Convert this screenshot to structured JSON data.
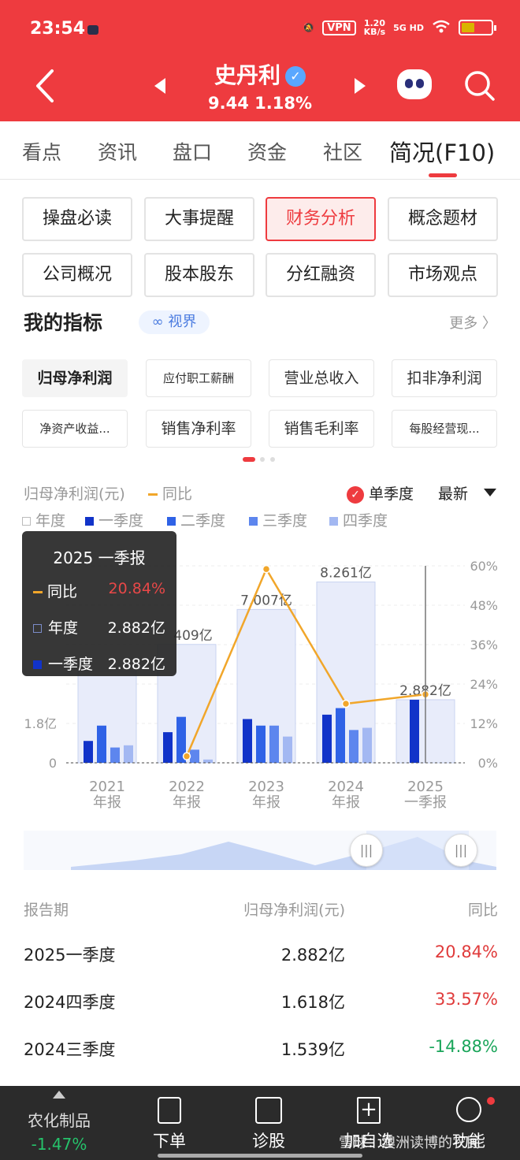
{
  "status_bar": {
    "time": "23:54",
    "vpn": "VPN",
    "speed_top": "1.20",
    "speed_bottom": "KB/s",
    "network": "5G HD"
  },
  "header": {
    "stock_name": "史丹利",
    "verified_icon": "✓",
    "price": "9.44",
    "change_pct": "1.18%"
  },
  "tabs": [
    "看点",
    "资讯",
    "盘口",
    "资金",
    "社区",
    "简况(F10)"
  ],
  "active_tab": 5,
  "quick_buttons": [
    "操盘必读",
    "大事提醒",
    "财务分析",
    "概念题材",
    "公司概况",
    "股本股东",
    "分红融资",
    "市场观点"
  ],
  "active_quick": 2,
  "indicators": {
    "title": "我的指标",
    "view_chip": "∞ 视界",
    "more": "更多 〉",
    "items": [
      "归母净利润",
      "应付职工薪酬",
      "营业总收入",
      "扣非净利润",
      "净资产收益...",
      "销售净利率",
      "销售毛利率",
      "每股经营现..."
    ]
  },
  "chart_header": {
    "title": "归母净利润(元)",
    "yoy": "同比",
    "single_quarter": "单季度",
    "check": "✓",
    "latest": "最新"
  },
  "legend": [
    "年度",
    "一季度",
    "二季度",
    "三季度",
    "四季度"
  ],
  "colors": {
    "brand_red": "#ee3b3f",
    "annual": "#e8ecfa",
    "q1": "#1133c9",
    "q2": "#2f62e6",
    "q3": "#5d86ee",
    "q4": "#a3b8f2",
    "yoy": "#f1a62a",
    "up": "#e03b3b",
    "down": "#1aa55a"
  },
  "chart_data": {
    "type": "bar",
    "categories": [
      "2021\n年报",
      "2022\n年报",
      "2023\n年报",
      "2024\n年报",
      "2025\n一季报"
    ],
    "series": [
      {
        "name": "年度",
        "values": [
          null,
          5.409,
          7.007,
          8.261,
          2.882
        ]
      },
      {
        "name": "一季度",
        "values": [
          1.0,
          1.4,
          2.0,
          2.2,
          2.882
        ]
      },
      {
        "name": "二季度",
        "values": [
          1.7,
          2.1,
          1.7,
          2.5,
          null
        ]
      },
      {
        "name": "三季度",
        "values": [
          0.7,
          0.6,
          1.7,
          1.5,
          null
        ]
      },
      {
        "name": "四季度",
        "values": [
          0.8,
          0.15,
          1.2,
          1.6,
          null
        ]
      }
    ],
    "bar_labels": [
      "",
      "409亿",
      "7.007亿",
      "8.261亿",
      "2.882亿"
    ],
    "yoy_line": {
      "name": "同比",
      "values": [
        null,
        2.0,
        59.0,
        18.0,
        20.84
      ]
    },
    "y_left_ticks": [
      "0",
      "1.8亿"
    ],
    "y_right_ticks": [
      "0%",
      "12%",
      "24%",
      "36%",
      "48%",
      "60%"
    ],
    "ylim_left": [
      0,
      9.0
    ],
    "ylim_right": [
      0,
      60
    ]
  },
  "tooltip": {
    "title": "2025 一季报",
    "rows": [
      {
        "label": "同比",
        "value": "20.84%"
      },
      {
        "label": "年度",
        "value": "2.882亿"
      },
      {
        "label": "一季度",
        "value": "2.882亿"
      }
    ]
  },
  "table": {
    "headers": [
      "报告期",
      "归母净利润(元)",
      "同比"
    ],
    "rows": [
      {
        "period": "2025一季度",
        "value": "2.882亿",
        "yoy": "20.84%",
        "dir": "up"
      },
      {
        "period": "2024四季度",
        "value": "1.618亿",
        "yoy": "33.57%",
        "dir": "up"
      },
      {
        "period": "2024三季度",
        "value": "1.539亿",
        "yoy": "-14.88%",
        "dir": "down"
      }
    ]
  },
  "bottom_bar": {
    "sector_name": "农化制品",
    "sector_change": "-1.47%",
    "items": [
      "下单",
      "诊股",
      "加自选",
      "功能"
    ],
    "watermark": "雪球：澳洲读博的农民"
  }
}
